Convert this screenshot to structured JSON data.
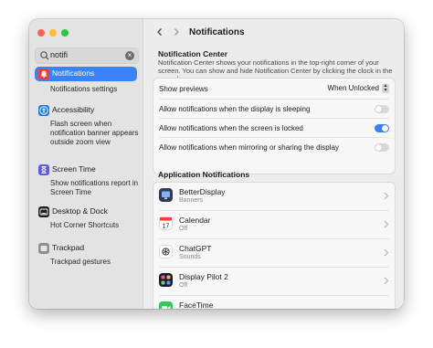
{
  "search": {
    "value": "notifi"
  },
  "sidebar": {
    "items": [
      {
        "label": "Notifications",
        "icon": "bell-badge-icon",
        "color": "#ff3b30",
        "subs": [
          "Notifications settings"
        ]
      },
      {
        "label": "Accessibility",
        "icon": "accessibility-icon",
        "color": "#1e7cf2",
        "subs": [
          "Flash screen when notification banner appears outside zoom view"
        ]
      },
      {
        "label": "Screen Time",
        "icon": "hourglass-icon",
        "color": "#5e5ce6",
        "subs": [
          "Show notifications report in Screen Time"
        ]
      },
      {
        "label": "Desktop & Dock",
        "icon": "dock-icon",
        "color": "#1d1d1f",
        "subs": [
          "Hot Corner Shortcuts"
        ]
      },
      {
        "label": "Trackpad",
        "icon": "trackpad-icon",
        "color": "#8e8e93",
        "subs": [
          "Trackpad gestures"
        ]
      }
    ]
  },
  "header": {
    "title": "Notifications"
  },
  "notification_center": {
    "title": "Notification Center",
    "description": "Notification Center shows your notifications in the top-right corner of your screen. You can show and hide Notification Center by clicking the clock in the menu bar."
  },
  "settings": {
    "show_previews": {
      "label": "Show previews",
      "value": "When Unlocked"
    },
    "toggles": [
      {
        "label": "Allow notifications when the display is sleeping",
        "on": false
      },
      {
        "label": "Allow notifications when the screen is locked",
        "on": true
      },
      {
        "label": "Allow notifications when mirroring or sharing the display",
        "on": false
      }
    ]
  },
  "apps": {
    "title": "Application Notifications",
    "items": [
      {
        "name": "BetterDisplay",
        "status": "Banners",
        "icon": "betterdisplay-icon"
      },
      {
        "name": "Calendar",
        "status": "Off",
        "icon": "calendar-icon",
        "day": "17"
      },
      {
        "name": "ChatGPT",
        "status": "Sounds",
        "icon": "chatgpt-icon"
      },
      {
        "name": "Display Pilot 2",
        "status": "Off",
        "icon": "display-pilot-icon"
      },
      {
        "name": "FaceTime",
        "status": "",
        "icon": "facetime-icon"
      }
    ]
  },
  "colors": {
    "accent": "#3a82f7"
  }
}
